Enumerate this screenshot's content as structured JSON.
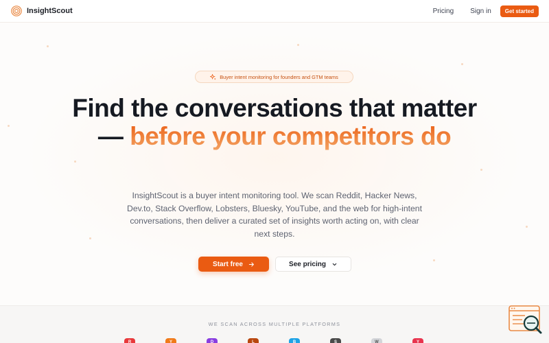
{
  "nav": {
    "brand": "InsightScout",
    "links": [
      "Pricing",
      "Sign in"
    ],
    "cta": "Get started"
  },
  "hero": {
    "badge": "Buyer intent monitoring for founders and GTM teams",
    "headline_part1": "Find the conversations that matter — ",
    "headline_accent": "before your competitors do",
    "description": "InsightScout is a buyer intent monitoring tool. We scan Reddit, Hacker News, Dev.to, Stack Overflow, Lobsters, Bluesky, YouTube, and the web for high-intent conversations, then deliver a curated set of insights worth acting on, with clear next steps.",
    "cta_primary": "Start free",
    "cta_secondary": "See pricing"
  },
  "platforms": {
    "label": "WE SCAN ACROSS MULTIPLE PLATFORMS",
    "icons": [
      {
        "name": "reddit-icon",
        "letter": "R",
        "color": "#e8393b"
      },
      {
        "name": "hacker-news-icon",
        "letter": "Y",
        "color": "#f07a1a"
      },
      {
        "name": "devto-icon",
        "letter": "D",
        "color": "#8a3ee0"
      },
      {
        "name": "lobsters-icon",
        "letter": "L",
        "color": "#b9470f"
      },
      {
        "name": "bluesky-icon",
        "letter": "B",
        "color": "#1ea3e6"
      },
      {
        "name": "stack-overflow-icon",
        "letter": "S",
        "color": "#4a4a4a"
      },
      {
        "name": "web-icon",
        "letter": "W",
        "color": "#d3d5d9"
      },
      {
        "name": "youtube-icon",
        "letter": "Y",
        "color": "#e8344e"
      }
    ]
  },
  "colors": {
    "accent": "#ea5b12",
    "text": "#161a22",
    "muted": "#5d6270"
  }
}
